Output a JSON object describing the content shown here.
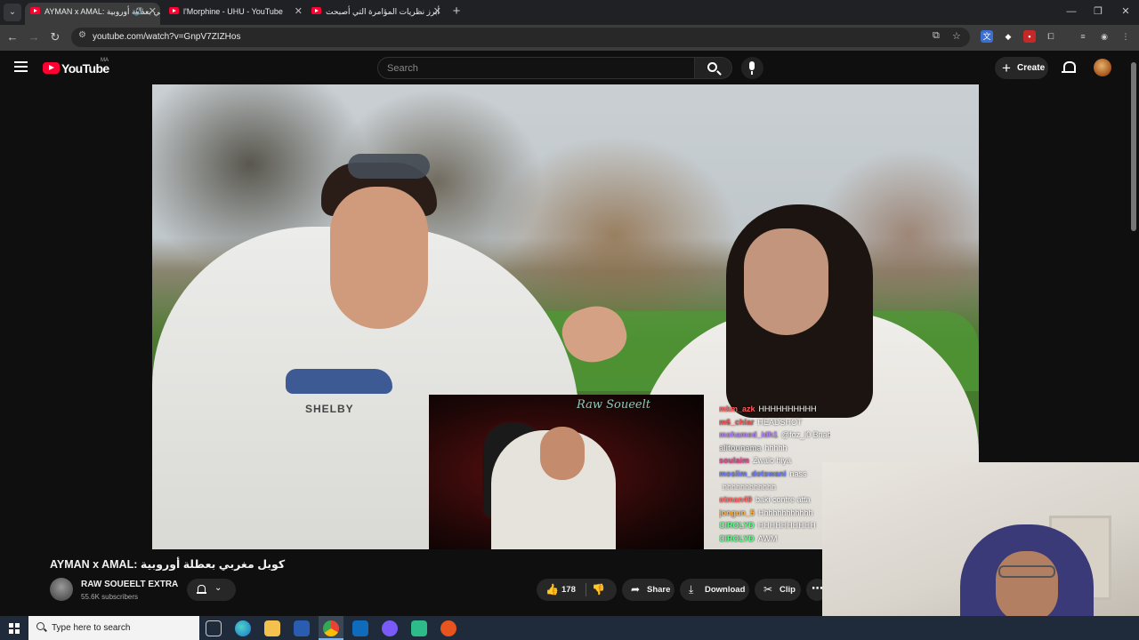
{
  "browser": {
    "tabs": [
      {
        "title": "AYMAN x AMAL: ﻛﻮﺑﻞ ﻣﻐﺮﺑﻲ ﺑﻌﻄﻠﺔ ﺃﻭﺭﻭﺑﻴﺔ",
        "active": true,
        "audio": true
      },
      {
        "title": "l'Morphine - UHU - YouTube",
        "active": false
      },
      {
        "title": "ﺃﺑﺮﺯ ﻧﻈﺮﻳﺎﺕ ﺍﻟﻤﺆﺍﻣﺮﺓ ﺍﻟﺘﻲ ﺃﺻﺒﺤﺖ",
        "active": false
      }
    ],
    "new_tab": "+",
    "url": "youtube.com/watch?v=GnpV7ZIZHos",
    "window_controls": {
      "minimize": "—",
      "restore": "❐",
      "close": "✕"
    }
  },
  "youtube": {
    "logo_text": "YouTube",
    "country_code": "MA",
    "search_placeholder": "Search",
    "create_label": "Create"
  },
  "video": {
    "reaction_title": "Raw Soueelt",
    "shirt_text": "SHELBY",
    "chat": [
      {
        "user": "mkm_azk",
        "message": "HHHHHHHHHH",
        "color": "#ff5a5a"
      },
      {
        "user": "m6_chlar",
        "message": "HEADSHOT",
        "color": "#ff4a4a"
      },
      {
        "user": "mohamed_idh1",
        "message": "@foz_i0 Bnadm frbl brb",
        "color": "#b57bff"
      },
      {
        "user": "alitounama",
        "message": "hhhhh",
        "color": "#e0e0e0"
      },
      {
        "user": "soulaim",
        "message": "Zwalo hiya",
        "color": "#d84a8a"
      },
      {
        "user": "moslim_dotswani",
        "message": "nass",
        "color": "#6a7aff"
      },
      {
        "user": "",
        "message": "hhhhhhhhhhhh",
        "color": "#ffffff"
      },
      {
        "user": "otman49",
        "message": "baki contre atta",
        "color": "#ff6a6a"
      },
      {
        "user": "jongun_5",
        "message": "Hhhhhhhhhhhh",
        "color": "#ffb84a"
      },
      {
        "user": "CIROLYD",
        "message": "HHHHHHHHHH",
        "color": "#5aff8a"
      },
      {
        "user": "CIROLYD",
        "message": "AWM",
        "color": "#5aff8a"
      }
    ]
  },
  "details": {
    "title": "AYMAN x AMAL: ﻛﻮﺑﻞ ﻣﻐﺮﺑﻲ ﺑﻌﻄﻠﺔ ﺃﻭﺭﻭﺑﻴﺔ",
    "channel_name": "RAW SOUEELT EXTRA",
    "subscribers": "55.6K subscribers",
    "likes": "178",
    "share_label": "Share",
    "download_label": "Download",
    "clip_label": "Clip"
  },
  "taskbar": {
    "search_placeholder": "Type here to search"
  },
  "colors": {
    "accent_red": "#ff0033",
    "background": "#0f0f0f",
    "pill": "#272727"
  }
}
